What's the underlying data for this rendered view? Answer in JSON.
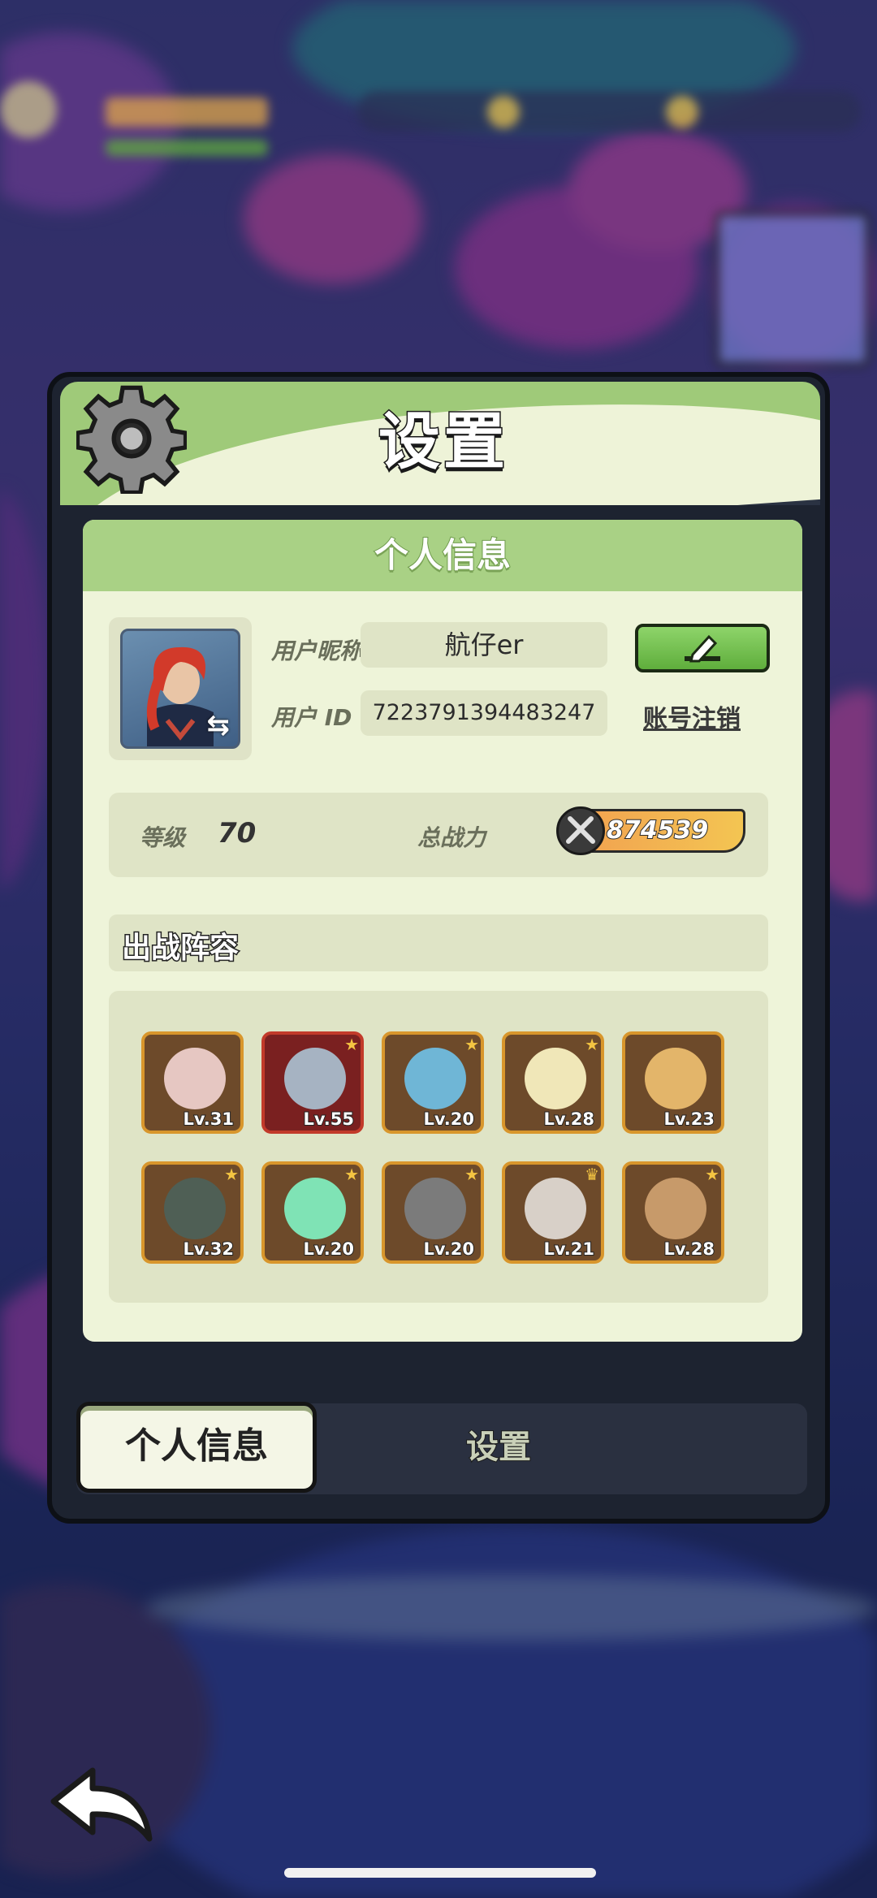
{
  "title": "设置",
  "profile_section": {
    "header": "个人信息",
    "nickname_label": "用户昵称",
    "nickname": "航仔er",
    "id_label": "用户 ID",
    "user_id": "7223791394483247",
    "deregister_label": "账号注销",
    "level_label": "等级",
    "level": "70",
    "power_label": "总战力",
    "power": "874539"
  },
  "lineup": {
    "header": "出战阵容",
    "heroes": [
      {
        "level": "Lv.31",
        "color": "#e6c7c2"
      },
      {
        "level": "Lv.55",
        "color": "#a6b3c2"
      },
      {
        "level": "Lv.20",
        "color": "#6fb6d6"
      },
      {
        "level": "Lv.28",
        "color": "#f0e7b8"
      },
      {
        "level": "Lv.23",
        "color": "#e3b56a"
      },
      {
        "level": "Lv.32",
        "color": "#4f5f55"
      },
      {
        "level": "Lv.20",
        "color": "#7fe3b5"
      },
      {
        "level": "Lv.20",
        "color": "#7b7b7b"
      },
      {
        "level": "Lv.21",
        "color": "#d8d0c8"
      },
      {
        "level": "Lv.28",
        "color": "#c79a6a"
      }
    ]
  },
  "tabs": {
    "active": "个人信息",
    "inactive": "设置"
  },
  "icons": {
    "settings": "gear-icon",
    "edit": "pencil-icon",
    "back": "back-arrow-icon",
    "swap": "swap-arrows-icon",
    "power": "crossed-swords-icon"
  },
  "colors": {
    "accent_green": "#9fca79",
    "card_bg": "#eef4d9",
    "hero_border": "#d8962c"
  }
}
